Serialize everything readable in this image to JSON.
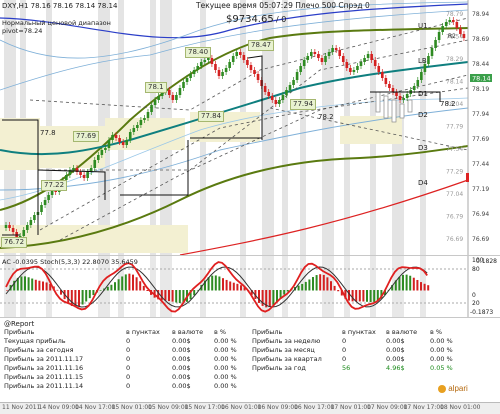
{
  "header": {
    "symbol_line": "DXY,H1  78.16 78.16 78.14 78.14",
    "info_line": "Текущее время 05:07:29 Плечо 500 Спрэд 0",
    "equity": "$9734.65",
    "equity_suffix": "/ 0",
    "indicator_name": "Нормальный ценовой диапазон",
    "pivot_label": "pivot=78.24"
  },
  "price_axis": [
    "78.79",
    "78.54",
    "78.29",
    "78.14",
    "78.04",
    "77.79",
    "77.54",
    "77.29",
    "77.04",
    "76.79",
    "76.69"
  ],
  "price_axis_alt": [
    "78.94",
    "78.69",
    "78.44",
    "78.19",
    "77.94",
    "77.69",
    "77.44",
    "77.19",
    "76.94",
    "76.69"
  ],
  "chart_labels": {
    "l1": "76.72",
    "l2": "77.22",
    "l3": "77.69",
    "l4": "77.8",
    "l5": "78.1",
    "l6": "77.84",
    "l7": "78.40",
    "l8": "78.47",
    "l9": "77.94",
    "l10": "78.2",
    "l11": "78.2"
  },
  "levels": [
    "U1",
    "R2",
    "LB",
    "D1",
    "D2",
    "D3",
    "D4"
  ],
  "current_price": "78.14",
  "osc": {
    "title": "AC -0.0395  Stoch(5,3,3) 22.8070 35.6459",
    "axis": [
      "100",
      "80",
      "20",
      "0",
      "0.1828",
      "-0.1873"
    ]
  },
  "report": {
    "title": "@Report",
    "header_left": [
      "Прибыль",
      "в пунктах",
      "в валюте",
      "в %"
    ],
    "rows_left": [
      [
        "Текущая прибыль",
        "0",
        "0.00$",
        "0.00 %"
      ],
      [
        "Прибыль за сегодня",
        "0",
        "0.00$",
        "0.00 %"
      ],
      [
        "Прибыль за 2011.11.17",
        "0",
        "0.00$",
        "0.00 %"
      ],
      [
        "Прибыль за 2011.11.16",
        "0",
        "0.00$",
        "0.00 %"
      ],
      [
        "Прибыль за 2011.11.15",
        "0",
        "0.00$",
        "0.00 %"
      ],
      [
        "Прибыль за 2011.11.14",
        "0",
        "0.00$",
        "0.00 %"
      ]
    ],
    "header_right": [
      "Прибыль",
      "в пунктах",
      "в валюте",
      "в %"
    ],
    "rows_right": [
      [
        "Прибыль за неделю",
        "0",
        "0.00$",
        "0.00 %"
      ],
      [
        "Прибыль за месяц",
        "0",
        "0.00$",
        "0.00 %"
      ],
      [
        "Прибыль за квартал",
        "0",
        "0.00$",
        "0.00 %"
      ],
      [
        "Прибыль за год",
        "56",
        "4.96$",
        "0.05 %"
      ]
    ],
    "brand": "alpari"
  },
  "time_axis": [
    "11 Nov 2011",
    "14 Nov 09:00",
    "14 Nov 17:00",
    "15 Nov 01:00",
    "15 Nov 09:00",
    "15 Nov 17:00",
    "16 Nov 01:00",
    "16 Nov 09:00",
    "16 Nov 17:00",
    "17 Nov 01:00",
    "17 Nov 09:00",
    "17 Nov 17:00",
    "18 Nov 01:00"
  ],
  "colors": {
    "bull": "#2e8b22",
    "bear": "#d42020",
    "teal": "#0f7f7f",
    "olive": "#5a7a10",
    "blue": "#2b3ec8",
    "red": "#dd2222",
    "stoch_red": "#e02020",
    "stoch_dark": "#333333"
  }
}
